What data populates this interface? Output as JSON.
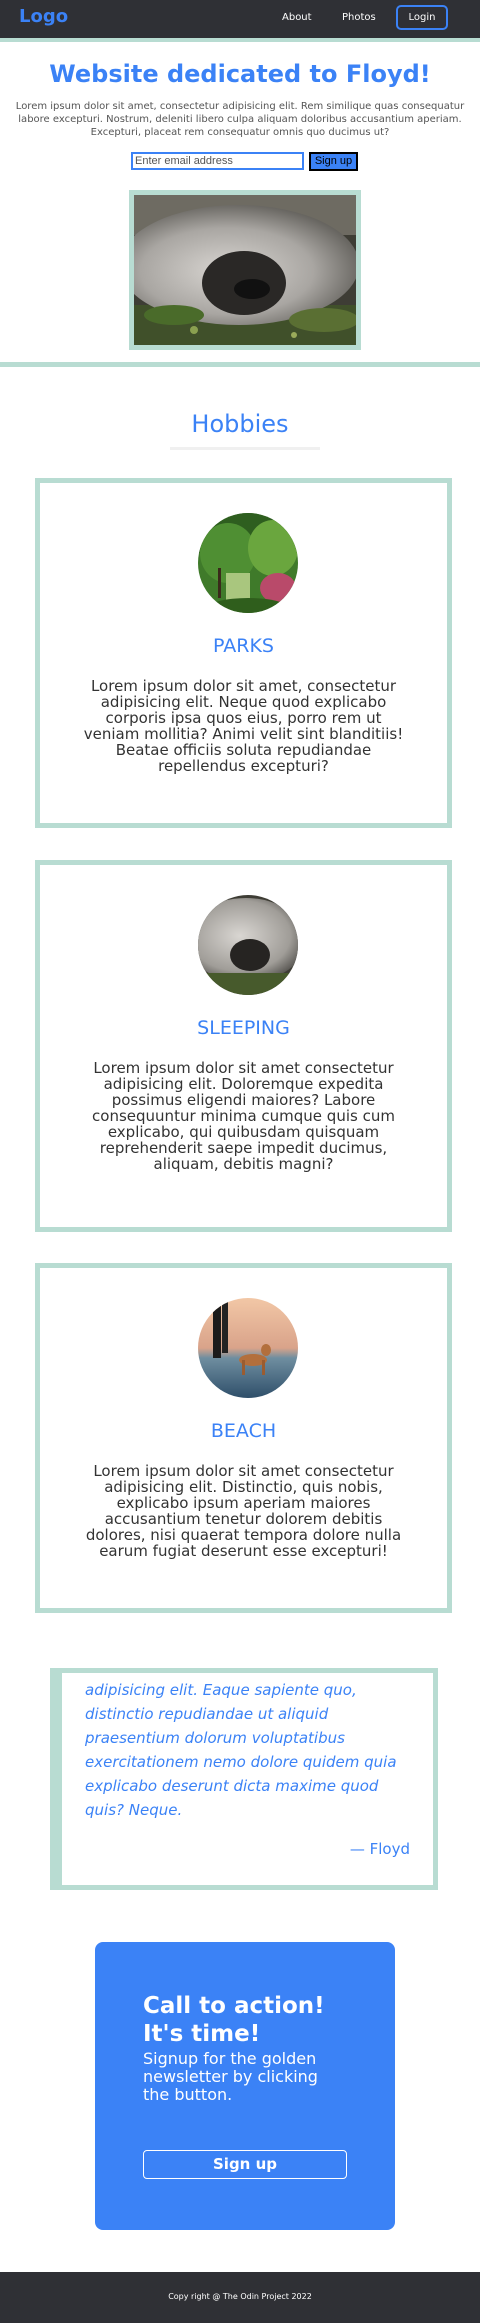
{
  "header": {
    "logo": "Logo",
    "nav": [
      "About",
      "Photos"
    ],
    "login": "Login"
  },
  "hero": {
    "title": "Website dedicated to Floyd!",
    "text": "Lorem ipsum dolor sit amet, consectetur adipisicing elit. Rem similique quas consequatur labore excepturi. Nostrum, deleniti libero culpa aliquam doloribus accusantium aperiam. Excepturi, placeat rem consequatur omnis quo ducimus ut?",
    "email_placeholder": "Enter email address",
    "signup": "Sign up"
  },
  "hobbies": {
    "title": "Hobbies",
    "cards": [
      {
        "title": "PARKS",
        "text": "Lorem ipsum dolor sit amet, consectetur adipisicing elit. Neque quod explicabo corporis ipsa quos eius, porro rem ut veniam mollitia? Animi velit sint blanditiis! Beatae officiis soluta repudiandae repellendus excepturi?"
      },
      {
        "title": "SLEEPING",
        "text": "Lorem ipsum dolor sit amet consectetur adipisicing elit. Doloremque expedita possimus eligendi maiores? Labore consequuntur minima cumque quis cum explicabo, qui quibusdam quisquam reprehenderit saepe impedit ducimus, aliquam, debitis magni?"
      },
      {
        "title": "BEACH",
        "text": "Lorem ipsum dolor sit amet consectetur adipisicing elit. Distinctio, quis nobis, explicabo ipsum aperiam maiores accusantium tenetur dolorem debitis dolores, nisi quaerat tempora dolore nulla earum fugiat deserunt esse excepturi!"
      }
    ]
  },
  "quote": {
    "text": "adipisicing elit. Eaque sapiente quo, distinctio repudiandae ut aliquid praesentium dolorum voluptatibus exercitationem nemo dolore quidem quia explicabo deserunt dicta maxime quod quis? Neque.",
    "author": "— Floyd"
  },
  "cta": {
    "title": "Call to action! It's time!",
    "text": "Signup for the golden newsletter by clicking the button.",
    "button": "Sign up"
  },
  "footer": {
    "text": "Copy right @ The Odin Project 2022"
  },
  "colors": {
    "accent": "#3b82f6",
    "border": "#b8dcd2",
    "header_bg": "#2f3035"
  }
}
